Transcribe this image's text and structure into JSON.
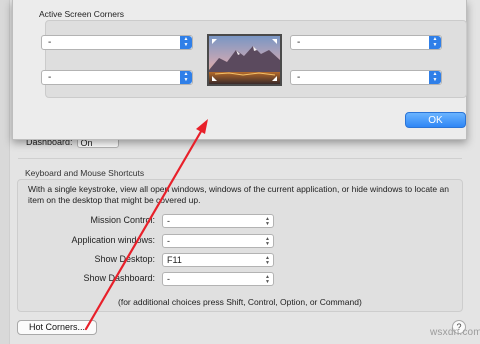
{
  "background_window": {
    "dashboard": {
      "label": "Dashboard:",
      "value": "On"
    },
    "keyboard_section_title": "Keyboard and Mouse Shortcuts",
    "description": "With a single keystroke, view all open windows, windows of the current application, or hide windows to locate an item on the desktop that might be covered up.",
    "shortcuts": [
      {
        "label": "Mission Control:",
        "value": "-"
      },
      {
        "label": "Application windows:",
        "value": "-"
      },
      {
        "label": "Show Desktop:",
        "value": "F11"
      },
      {
        "label": "Show Dashboard:",
        "value": "-"
      }
    ],
    "footnote": "(for additional choices press Shift, Control, Option, or Command)",
    "hot_corners_button": "Hot Corners...",
    "help_button": "?"
  },
  "sheet": {
    "title": "Active Screen Corners",
    "corners": {
      "top_left": "-",
      "top_right": "-",
      "bottom_left": "-",
      "bottom_right": "-"
    },
    "ok_button": "OK"
  },
  "watermark": "wsxdn.com",
  "colors": {
    "annotation_arrow": "#e8202a",
    "accent_blue": "#2f7fe8"
  },
  "icons": {
    "popup_arrows": "up-down-chevrons-icon",
    "help": "question-mark-icon"
  }
}
